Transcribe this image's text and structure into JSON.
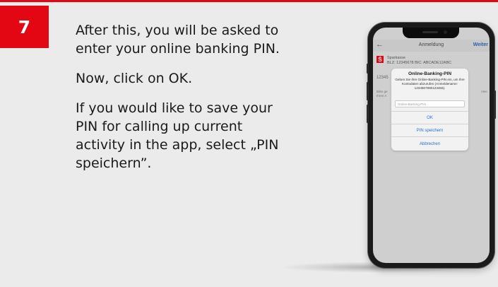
{
  "step": {
    "number": "7"
  },
  "instructions": {
    "paragraph1": "After this, you will be asked to enter your online banking PIN.",
    "paragraph2": "Now, click on OK.",
    "paragraph3": "If you would like to save your PIN for calling up current activity in the app, select „PIN speichern”."
  },
  "phone": {
    "navbar": {
      "title": "Anmeldung",
      "next_label": "Weiter"
    },
    "bank": {
      "name": "Sparkasse",
      "ids": "BLZ: 12345678  BIC: ABCADE12ABC",
      "account_number_partial": "12345",
      "hint_left": "Bitte ge Ihres A",
      "hint_right": "nten"
    },
    "dialog": {
      "title": "Online-Banking-PIN",
      "message": "Geben Sie Ihre Online-Banking-PIN ein, um Ihre Kontodaten abzurufen (Anmeldename: 1234567890123456).",
      "input_placeholder": "Online-Banking-PIN",
      "ok_label": "OK",
      "save_pin_label": "PIN speichern",
      "cancel_label": "Abbrechen"
    }
  },
  "colors": {
    "accent": "#e30613",
    "ios_blue": "#2a6fd1",
    "background": "#ebebeb"
  },
  "icons": [
    "back-arrow-icon",
    "sparkasse-logo-icon"
  ]
}
